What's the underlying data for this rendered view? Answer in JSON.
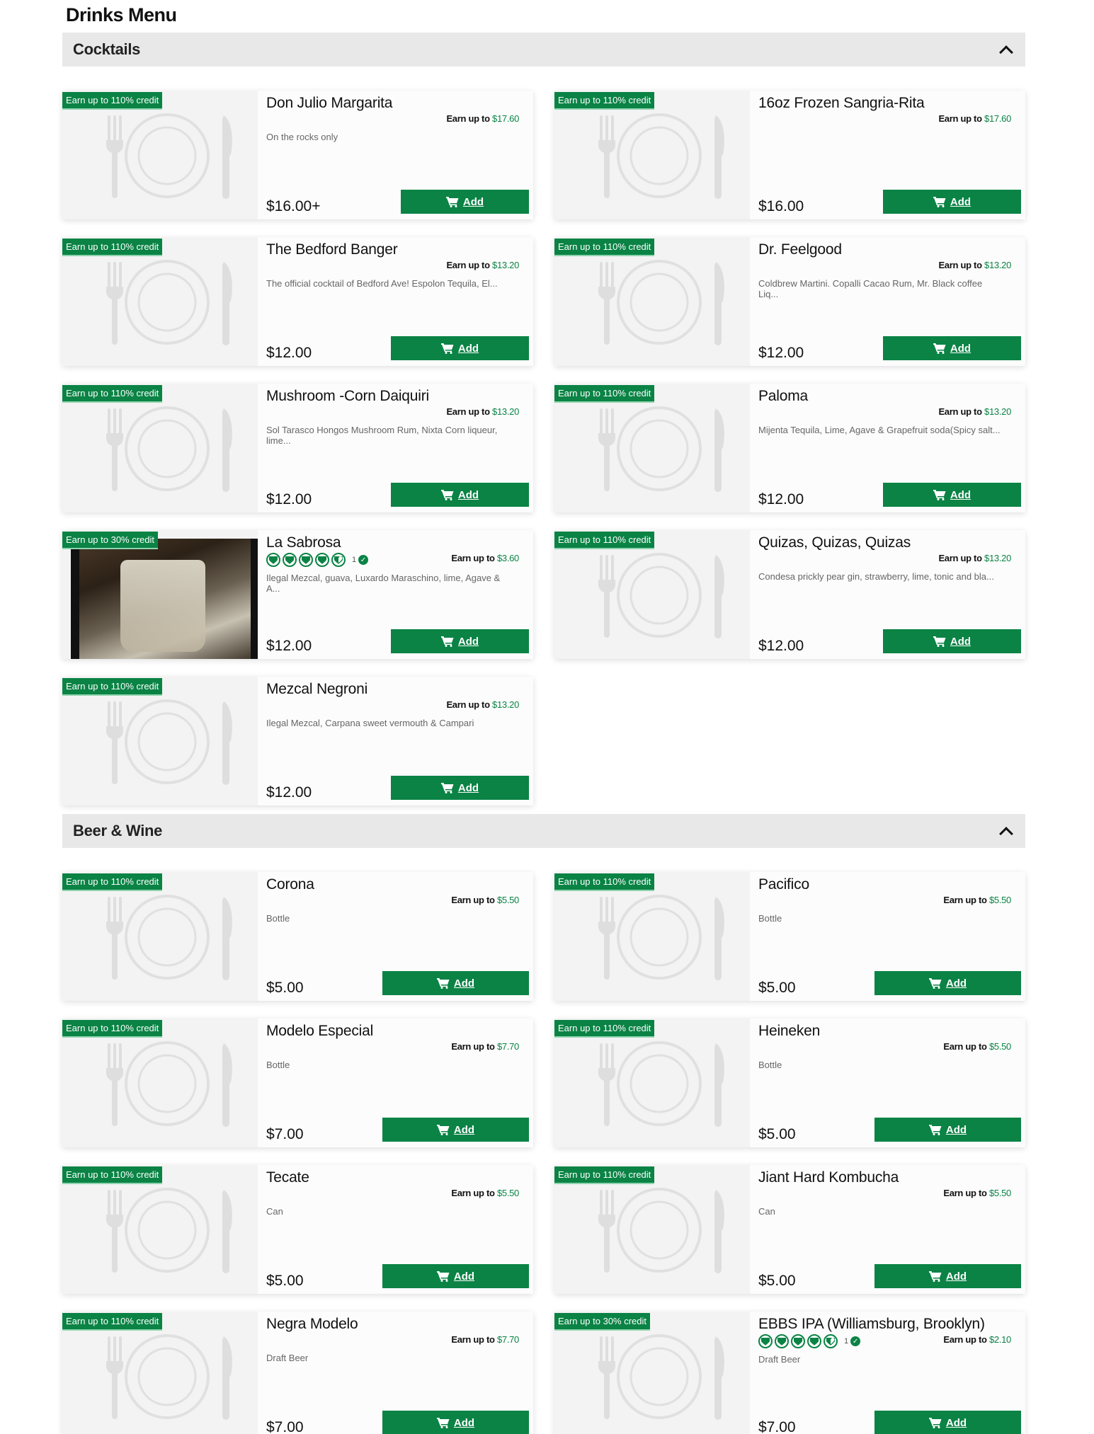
{
  "page": {
    "title": "Drinks Menu"
  },
  "colors": {
    "accent": "#0a8345",
    "section_bg": "#e8e8e8"
  },
  "icons": {
    "cart": "cart-icon",
    "collapse": "chevron-up-icon",
    "placeholder": "plate-fork-knife-icon"
  },
  "sections": [
    {
      "title": "Cocktails",
      "items": [
        {
          "badge": "Earn up to 110% credit",
          "name": "Don Julio Margarita",
          "earn_label": "Earn up to",
          "earn_amount": "$17.60",
          "description": "On the rocks only",
          "price": "$16.00+",
          "add_label": "Add"
        },
        {
          "badge": "Earn up to 110% credit",
          "name": "16oz Frozen Sangria-Rita",
          "earn_label": "Earn up to",
          "earn_amount": "$17.60",
          "description": "",
          "price": "$16.00",
          "add_label": "Add"
        },
        {
          "badge": "Earn up to 110% credit",
          "name": "The Bedford Banger",
          "earn_label": "Earn up to",
          "earn_amount": "$13.20",
          "description": "The official cocktail of Bedford Ave! Espolon Tequila, El...",
          "price": "$12.00",
          "add_label": "Add"
        },
        {
          "badge": "Earn up to 110% credit",
          "name": "Dr. Feelgood",
          "earn_label": "Earn up to",
          "earn_amount": "$13.20",
          "description": "Coldbrew Martini. Copalli Cacao Rum, Mr. Black coffee Liq...",
          "price": "$12.00",
          "add_label": "Add"
        },
        {
          "badge": "Earn up to 110% credit",
          "name": "Mushroom -Corn Daiquiri",
          "earn_label": "Earn up to",
          "earn_amount": "$13.20",
          "description": "Sol Tarasco Hongos Mushroom Rum, Nixta Corn liqueur, lime...",
          "price": "$12.00",
          "add_label": "Add"
        },
        {
          "badge": "Earn up to 110% credit",
          "name": "Paloma",
          "earn_label": "Earn up to",
          "earn_amount": "$13.20",
          "description": "Mijenta Tequila, Lime, Agave & Grapefruit soda(Spicy salt...",
          "price": "$12.00",
          "add_label": "Add"
        },
        {
          "badge": "Earn up to 30% credit",
          "name": "La Sabrosa",
          "earn_label": "Earn up to",
          "earn_amount": "$3.60",
          "description": "Ilegal Mezcal, guava, Luxardo Maraschino, lime, Agave & A...",
          "price": "$12.00",
          "add_label": "Add",
          "has_photo": true,
          "rating": {
            "value": 4.5,
            "count": "1"
          }
        },
        {
          "badge": "Earn up to 110% credit",
          "name": "Quizas, Quizas, Quizas",
          "earn_label": "Earn up to",
          "earn_amount": "$13.20",
          "description": "Condesa prickly pear gin, strawberry, lime, tonic and bla...",
          "price": "$12.00",
          "add_label": "Add"
        },
        {
          "badge": "Earn up to 110% credit",
          "name": "Mezcal Negroni",
          "earn_label": "Earn up to",
          "earn_amount": "$13.20",
          "description": "Ilegal Mezcal, Carpana sweet vermouth & Campari",
          "price": "$12.00",
          "add_label": "Add"
        }
      ]
    },
    {
      "title": "Beer & Wine",
      "items": [
        {
          "badge": "Earn up to 110% credit",
          "name": "Corona",
          "earn_label": "Earn up to",
          "earn_amount": "$5.50",
          "description": "Bottle",
          "price": "$5.00",
          "add_label": "Add"
        },
        {
          "badge": "Earn up to 110% credit",
          "name": "Pacifico",
          "earn_label": "Earn up to",
          "earn_amount": "$5.50",
          "description": "Bottle",
          "price": "$5.00",
          "add_label": "Add"
        },
        {
          "badge": "Earn up to 110% credit",
          "name": "Modelo Especial",
          "earn_label": "Earn up to",
          "earn_amount": "$7.70",
          "description": "Bottle",
          "price": "$7.00",
          "add_label": "Add"
        },
        {
          "badge": "Earn up to 110% credit",
          "name": "Heineken",
          "earn_label": "Earn up to",
          "earn_amount": "$5.50",
          "description": "Bottle",
          "price": "$5.00",
          "add_label": "Add"
        },
        {
          "badge": "Earn up to 110% credit",
          "name": "Tecate",
          "earn_label": "Earn up to",
          "earn_amount": "$5.50",
          "description": "Can",
          "price": "$5.00",
          "add_label": "Add"
        },
        {
          "badge": "Earn up to 110% credit",
          "name": "Jiant Hard Kombucha",
          "earn_label": "Earn up to",
          "earn_amount": "$5.50",
          "description": "Can",
          "price": "$5.00",
          "add_label": "Add"
        },
        {
          "badge": "Earn up to 110% credit",
          "name": "Negra Modelo",
          "earn_label": "Earn up to",
          "earn_amount": "$7.70",
          "description": "Draft Beer",
          "price": "$7.00",
          "add_label": "Add"
        },
        {
          "badge": "Earn up to 30% credit",
          "name": "EBBS IPA (Williamsburg, Brooklyn)",
          "earn_label": "Earn up to",
          "earn_amount": "$2.10",
          "description": "Draft Beer",
          "price": "$7.00",
          "add_label": "Add",
          "rating": {
            "value": 4.5,
            "count": "1"
          }
        }
      ]
    }
  ]
}
